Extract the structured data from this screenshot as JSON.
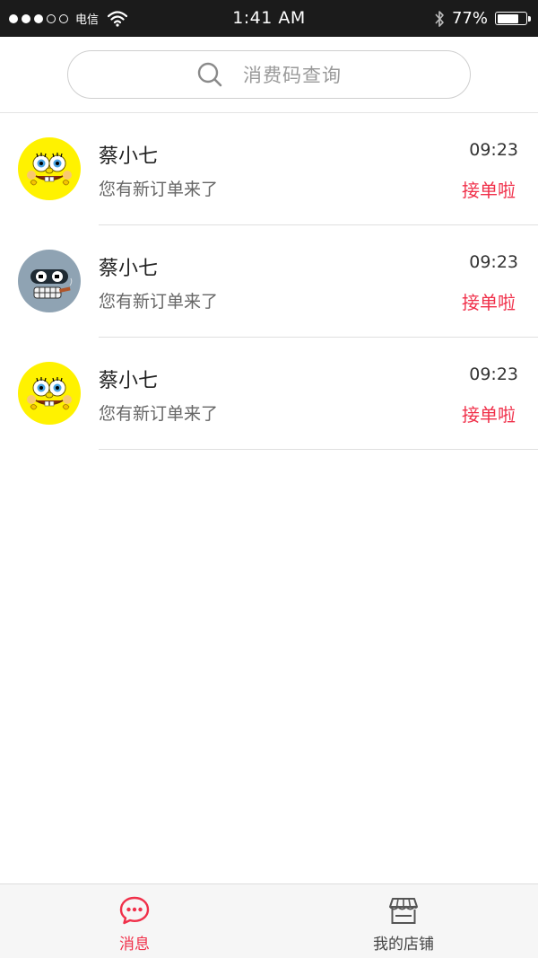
{
  "status_bar": {
    "signal_filled": 3,
    "signal_empty": 2,
    "carrier": "电信",
    "time": "1:41 AM",
    "battery_percent_text": "77%",
    "battery_level": 0.77
  },
  "search": {
    "placeholder": "消费码查询"
  },
  "messages": [
    {
      "name": "蔡小七",
      "time": "09:23",
      "text": "您有新订单来了",
      "action": "接单啦",
      "avatar": "spongebob"
    },
    {
      "name": "蔡小七",
      "time": "09:23",
      "text": "您有新订单来了",
      "action": "接单啦",
      "avatar": "robot"
    },
    {
      "name": "蔡小七",
      "time": "09:23",
      "text": "您有新订单来了",
      "action": "接单啦",
      "avatar": "spongebob"
    }
  ],
  "tabs": [
    {
      "label": "消息",
      "icon": "chat-bubble-icon",
      "active": true
    },
    {
      "label": "我的店铺",
      "icon": "store-icon",
      "active": false
    }
  ],
  "colors": {
    "accent": "#f0304a",
    "status_bar_bg": "#1b1b1b",
    "spongebob_yellow": "#fff200",
    "robot_gray": "#8fa3b3"
  }
}
